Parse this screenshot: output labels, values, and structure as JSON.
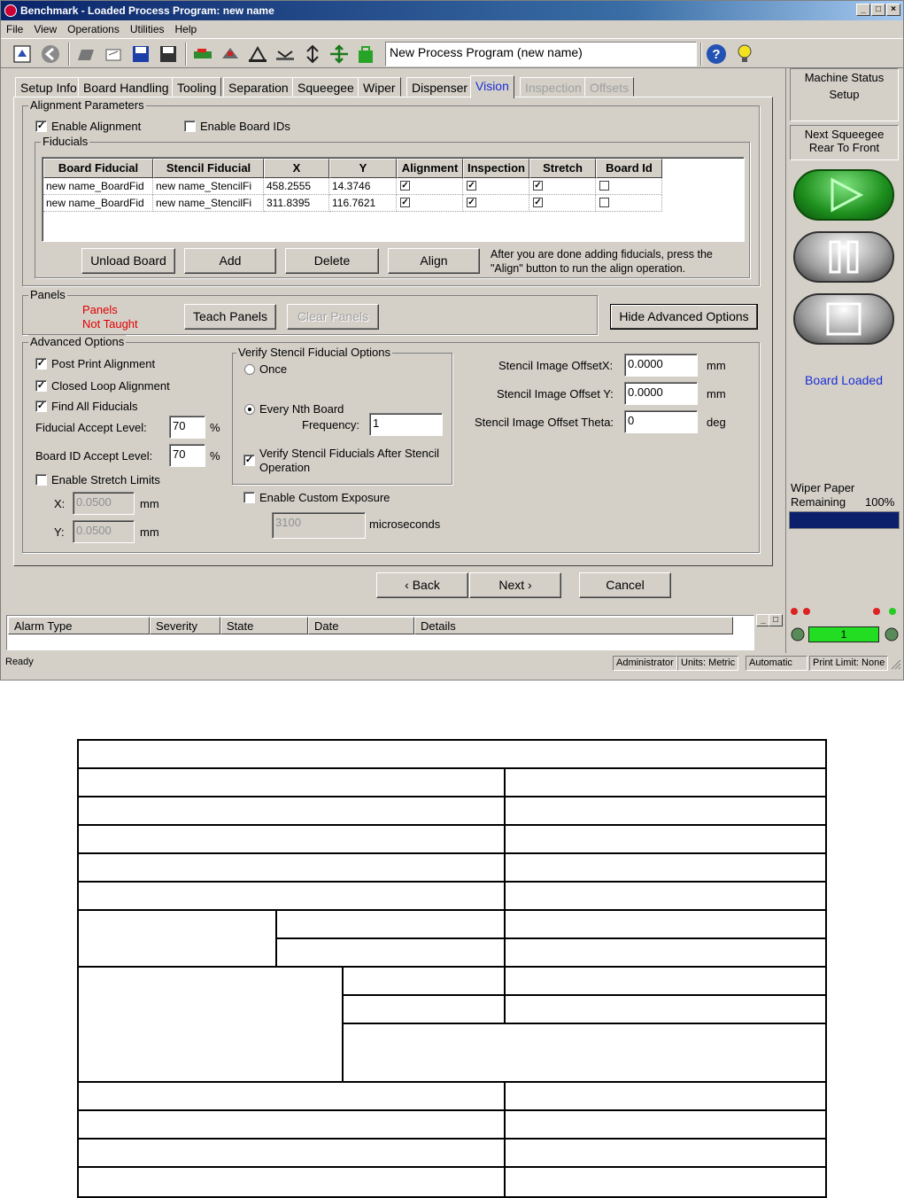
{
  "window": {
    "title": "Benchmark - Loaded Process Program:  new name",
    "minimize": "_",
    "maximize": "□",
    "close": "×"
  },
  "menu": [
    "File",
    "View",
    "Operations",
    "Utilities",
    "Help"
  ],
  "toolbar": {
    "icons": [
      "ssp-icon",
      "back-arrow-icon",
      "open-folder-icon",
      "edit-icon",
      "save-icon",
      "save-all-icon",
      "board-icon",
      "tool-icon",
      "squeegee-icon",
      "separation-icon",
      "stencil-icon",
      "align-icon",
      "lock-icon",
      "help-icon",
      "lightbulb-icon"
    ],
    "process_program_name": "New Process Program (new name)"
  },
  "tabs": [
    {
      "label": "Setup Info",
      "state": "normal"
    },
    {
      "label": "Board Handling",
      "state": "normal"
    },
    {
      "label": "Tooling",
      "state": "normal"
    },
    {
      "label": "Separation",
      "state": "normal"
    },
    {
      "label": "Squeegee",
      "state": "normal"
    },
    {
      "label": "Wiper",
      "state": "normal"
    },
    {
      "label": "Dispenser",
      "state": "normal"
    },
    {
      "label": "Vision",
      "state": "active"
    },
    {
      "label": "Inspection",
      "state": "disabled"
    },
    {
      "label": "Offsets",
      "state": "disabled"
    }
  ],
  "alignment": {
    "legend": "Alignment Parameters",
    "enable_alignment": {
      "label": "Enable Alignment",
      "checked": true
    },
    "enable_board_ids": {
      "label": "Enable Board IDs",
      "checked": false
    },
    "fiducials_legend": "Fiducials",
    "columns": [
      "Board Fiducial",
      "Stencil Fiducial",
      "X",
      "Y",
      "Alignment",
      "Inspection",
      "Stretch",
      "Board Id"
    ],
    "rows": [
      {
        "board": "new name_BoardFid",
        "stencil": "new name_StencilFi",
        "x": "458.2555",
        "y": "14.3746",
        "alignment": true,
        "inspection": true,
        "stretch": true,
        "board_id": false
      },
      {
        "board": "new name_BoardFid",
        "stencil": "new name_StencilFi",
        "x": "311.8395",
        "y": "116.7621",
        "alignment": true,
        "inspection": true,
        "stretch": true,
        "board_id": false
      }
    ],
    "buttons": {
      "unload": "Unload Board",
      "add": "Add",
      "delete": "Delete",
      "align": "Align"
    },
    "help_line1": "After you are done adding fiducials, press the",
    "help_line2": "\"Align\" button to run the align operation."
  },
  "panels": {
    "legend": "Panels",
    "status_line1": "Panels",
    "status_line2": "Not Taught",
    "status_color": "#e00000",
    "teach": "Teach Panels",
    "clear": "Clear Panels",
    "hide_advanced": "Hide Advanced Options"
  },
  "advanced": {
    "legend": "Advanced Options",
    "post_print": {
      "label": "Post Print Alignment",
      "checked": true
    },
    "closed_loop": {
      "label": "Closed Loop Alignment",
      "checked": true
    },
    "find_all": {
      "label": "Find All Fiducials",
      "checked": true
    },
    "fiducial_accept": {
      "label": "Fiducial Accept Level:",
      "value": "70",
      "unit": "%"
    },
    "board_id_accept": {
      "label": "Board ID Accept Level:",
      "value": "70",
      "unit": "%"
    },
    "stretch_limits": {
      "label": "Enable Stretch Limits",
      "checked": false
    },
    "stretch_x": {
      "label": "X:",
      "value": "0.0500",
      "unit": "mm"
    },
    "stretch_y": {
      "label": "Y:",
      "value": "0.0500",
      "unit": "mm"
    },
    "verify": {
      "legend": "Verify Stencil Fiducial Options",
      "once": "Once",
      "every_nth": "Every Nth Board",
      "selected": "every_nth",
      "frequency_label": "Frequency:",
      "frequency": "1",
      "after_stencil_line1": "Verify Stencil Fiducials After Stencil",
      "after_stencil_line2": "Operation",
      "after_stencil_checked": true
    },
    "custom_exposure": {
      "label": "Enable Custom Exposure",
      "checked": false,
      "value": "3100",
      "unit": "microseconds"
    },
    "offset_x": {
      "label": "Stencil Image OffsetX:",
      "value": "0.0000",
      "unit": "mm"
    },
    "offset_y": {
      "label": "Stencil Image Offset Y:",
      "value": "0.0000",
      "unit": "mm"
    },
    "offset_theta": {
      "label": "Stencil Image Offset Theta:",
      "value": "0",
      "unit": "deg"
    }
  },
  "nav": {
    "back": "‹ Back",
    "next": "Next ›",
    "cancel": "Cancel"
  },
  "right": {
    "machine_status_label": "Machine Status",
    "machine_status": "Setup",
    "next_squeegee_label": "Next Squeegee",
    "next_squeegee": "Rear To Front",
    "board_status": "Board Loaded",
    "wiper_label1": "Wiper Paper",
    "wiper_label2": "Remaining",
    "wiper_percent": "100%",
    "wiper_fraction": 1.0,
    "counter": "1"
  },
  "alarms": {
    "columns": [
      "Alarm Type",
      "Severity",
      "State",
      "Date",
      "Details"
    ]
  },
  "status": {
    "ready": "Ready",
    "user": "Administrator",
    "units": "Units: Metric",
    "mode": "Automatic",
    "print_limit": "Print Limit: None"
  },
  "colors": {
    "accent_tab": "#1a2ed6",
    "board_loaded": "#1a2ed6",
    "wiper_bar": "#0b1f6b",
    "play_green": "#1d8f1d",
    "counter_green": "#22dd22"
  }
}
